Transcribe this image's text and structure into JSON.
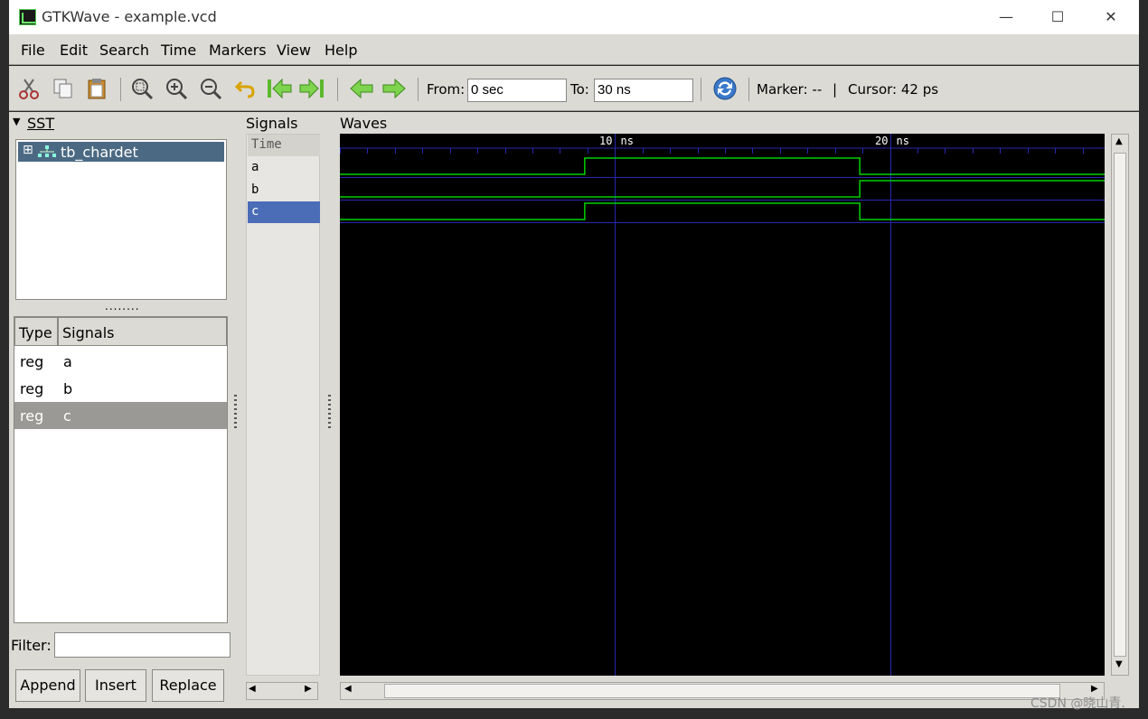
{
  "window": {
    "title": "GTKWave - example.vcd",
    "minimize": "—",
    "maximize": "☐",
    "close": "✕"
  },
  "menu": [
    "File",
    "Edit",
    "Search",
    "Time",
    "Markers",
    "View",
    "Help"
  ],
  "toolbar": {
    "from_label": "From:",
    "from_value": "0 sec",
    "to_label": "To:",
    "to_value": "30 ns",
    "marker_text": "Marker: --",
    "separator": "|",
    "cursor_text": "Cursor: 42 ps"
  },
  "sst": {
    "title": "SST",
    "tree_expander": "⊞",
    "tree_item": "tb_chardet",
    "grip": "........"
  },
  "signal_table": {
    "columns": [
      "Type",
      "Signals"
    ],
    "rows": [
      {
        "type": "reg",
        "name": "a"
      },
      {
        "type": "reg",
        "name": "b"
      },
      {
        "type": "reg",
        "name": "c"
      }
    ],
    "selected_index": 2
  },
  "filter": {
    "label": "Filter:",
    "value": ""
  },
  "buttons": {
    "append": "Append",
    "insert": "Insert",
    "replace": "Replace"
  },
  "signals_pane": {
    "title": "Signals",
    "rows": [
      "Time",
      "a",
      "b",
      "c"
    ],
    "selected": "c"
  },
  "waves_pane": {
    "title": "Waves",
    "time_labels": [
      "10 ns",
      "20 ns"
    ],
    "range_ns": [
      0,
      27.8
    ],
    "signals": [
      {
        "name": "a",
        "transitions": [
          [
            0,
            0
          ],
          [
            8.9,
            1
          ],
          [
            18.9,
            0
          ]
        ]
      },
      {
        "name": "b",
        "transitions": [
          [
            0,
            0
          ],
          [
            18.9,
            1
          ]
        ]
      },
      {
        "name": "c",
        "transitions": [
          [
            0,
            0
          ],
          [
            8.9,
            1
          ],
          [
            18.9,
            0
          ]
        ]
      }
    ]
  },
  "colors": {
    "wave": "#00d000",
    "grid": "#2828b0",
    "selection": "#4b6983",
    "bg": "#dcdad5"
  },
  "watermark": "CSDN @晓山青."
}
